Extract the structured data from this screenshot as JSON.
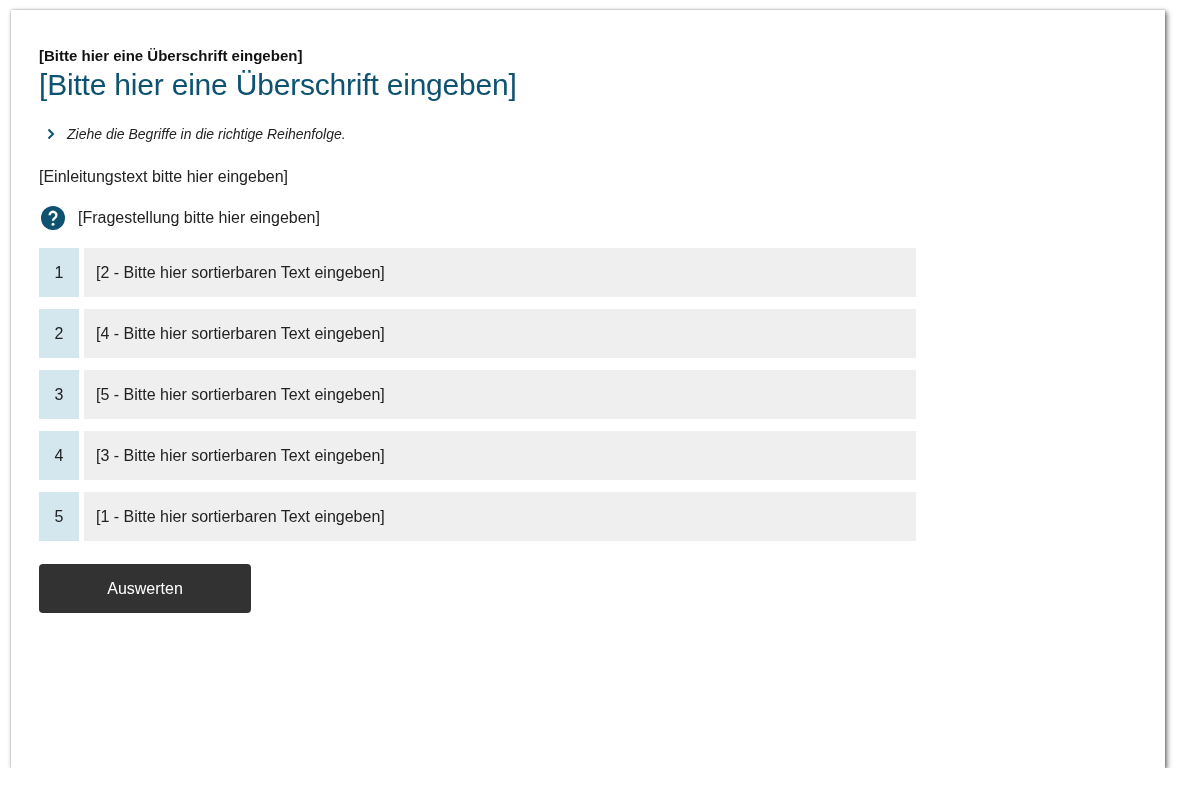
{
  "subheading": "[Bitte hier eine Überschrift eingeben]",
  "heading": "[Bitte hier eine Überschrift eingeben]",
  "instruction": "Ziehe die Begriffe in die richtige Reihenfolge.",
  "intro": "[Einleitungstext bitte hier eingeben]",
  "question": "[Fragestellung bitte hier eingeben]",
  "items": [
    {
      "number": "1",
      "text": "[2 - Bitte hier sortierbaren Text eingeben]"
    },
    {
      "number": "2",
      "text": "[4 - Bitte hier sortierbaren Text eingeben]"
    },
    {
      "number": "3",
      "text": "[5 - Bitte hier sortierbaren Text eingeben]"
    },
    {
      "number": "4",
      "text": "[3 - Bitte hier sortierbaren Text eingeben]"
    },
    {
      "number": "5",
      "text": "[1 - Bitte hier sortierbaren Text eingeben]"
    }
  ],
  "button": "Auswerten"
}
